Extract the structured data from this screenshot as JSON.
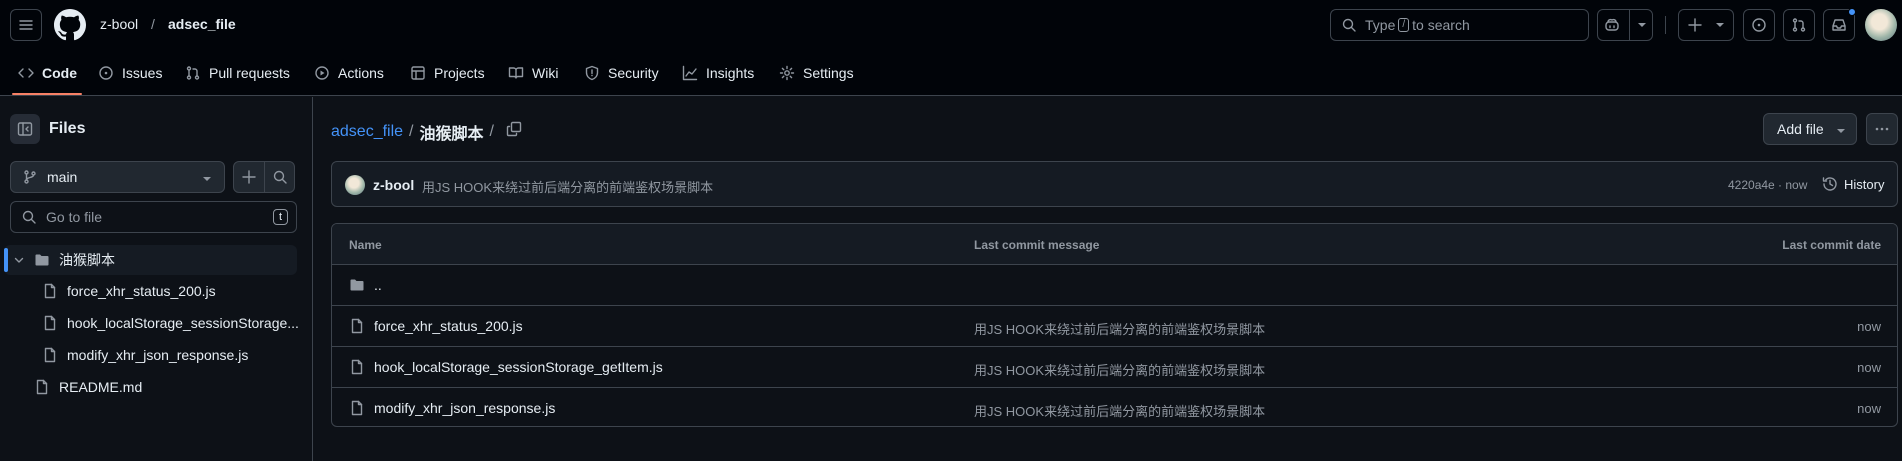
{
  "header": {
    "owner": "z-bool",
    "separator": "/",
    "repo": "adsec_file",
    "search_prefix": "Type",
    "search_key": "/",
    "search_suffix": "to search"
  },
  "tabs": [
    {
      "label": "Code"
    },
    {
      "label": "Issues"
    },
    {
      "label": "Pull requests"
    },
    {
      "label": "Actions"
    },
    {
      "label": "Projects"
    },
    {
      "label": "Wiki"
    },
    {
      "label": "Security"
    },
    {
      "label": "Insights"
    },
    {
      "label": "Settings"
    }
  ],
  "colors": {
    "accent": "#4493f8",
    "tab_underline": "#f78166",
    "background": "#0d1117"
  },
  "sidebar": {
    "title": "Files",
    "branch": "main",
    "go_to_file_placeholder": "Go to file",
    "go_to_file_key": "t",
    "folder": "油猴脚本",
    "children": [
      "force_xhr_status_200.js",
      "hook_localStorage_sessionStorage...",
      "modify_xhr_json_response.js"
    ],
    "root_files": [
      "README.md"
    ]
  },
  "main": {
    "breadcrumb_repo": "adsec_file",
    "breadcrumb_sep": "/",
    "breadcrumb_current": "油猴脚本",
    "breadcrumb_trailing": "/",
    "add_file_label": "Add file",
    "more_label": "···"
  },
  "commit": {
    "author": "z-bool",
    "message": "用JS HOOK来绕过前后端分离的前端鉴权场景脚本",
    "sha_time": "4220a4e · now",
    "history_label": "History"
  },
  "table": {
    "headers": {
      "name": "Name",
      "message": "Last commit message",
      "date": "Last commit date"
    },
    "parent_dir": "..",
    "rows": [
      {
        "name": "force_xhr_status_200.js",
        "message": "用JS HOOK来绕过前后端分离的前端鉴权场景脚本",
        "date": "now"
      },
      {
        "name": "hook_localStorage_sessionStorage_getItem.js",
        "message": "用JS HOOK来绕过前后端分离的前端鉴权场景脚本",
        "date": "now"
      },
      {
        "name": "modify_xhr_json_response.js",
        "message": "用JS HOOK来绕过前后端分离的前端鉴权场景脚本",
        "date": "now"
      }
    ]
  }
}
